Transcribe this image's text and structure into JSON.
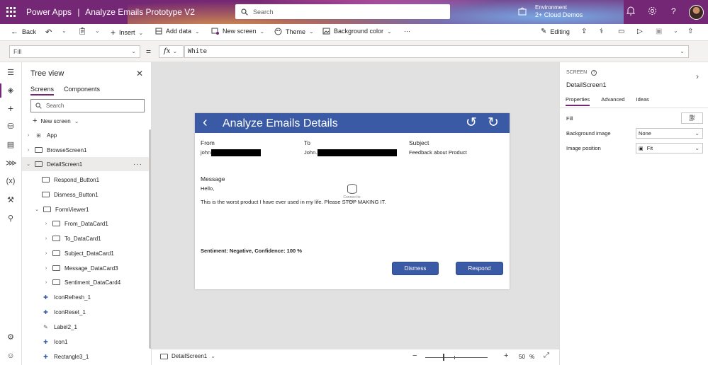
{
  "titlebar": {
    "app_name": "Power Apps",
    "separator": "|",
    "doc_name": "Analyze Emails Prototype V2",
    "search_placeholder": "Search",
    "env_label": "Environment",
    "env_value": "2+ Cloud Demos"
  },
  "commands": {
    "back": "Back",
    "insert": "Insert",
    "add_data": "Add data",
    "new_screen": "New screen",
    "theme": "Theme",
    "background_color": "Background color",
    "more": "···",
    "editing": "Editing"
  },
  "formula_bar": {
    "property": "Fill",
    "equals": "=",
    "fx": "fx",
    "formula": "White"
  },
  "tree": {
    "title": "Tree view",
    "tabs": [
      "Screens",
      "Components"
    ],
    "search_placeholder": "Search",
    "new_screen": "New screen",
    "items": [
      {
        "label": "App"
      },
      {
        "label": "BrowseScreen1"
      },
      {
        "label": "DetailScreen1"
      },
      {
        "label": "Respond_Button1"
      },
      {
        "label": "Dismess_Button1"
      },
      {
        "label": "FormViewer1"
      },
      {
        "label": "From_DataCard1"
      },
      {
        "label": "To_DataCard1"
      },
      {
        "label": "Subject_DataCard1"
      },
      {
        "label": "Message_DataCard3"
      },
      {
        "label": "Sentiment_DataCard4"
      },
      {
        "label": "IconRefresh_1"
      },
      {
        "label": "IconReset_1"
      },
      {
        "label": "Label2_1"
      },
      {
        "label": "Icon1"
      },
      {
        "label": "Rectangle3_1"
      }
    ]
  },
  "app_screen": {
    "title": "Analyze Emails Details",
    "from_label": "From",
    "from_value": "john",
    "to_label": "To",
    "to_value": "John.",
    "subject_label": "Subject",
    "subject_value": "Feedback about Product",
    "message_label": "Message",
    "message_line1": "Hello,",
    "message_line2": "This is the worst product I have ever used in my life. Please STOP MAKING IT.",
    "connect_hint": "Connect to data",
    "sentiment": "Sentiment: Negative, Confidence: 100 %",
    "dismiss": "Dismess",
    "respond": "Respond"
  },
  "statusbar": {
    "screen": "DetailScreen1",
    "zoom": "50",
    "zoom_unit": "%"
  },
  "properties": {
    "kind": "SCREEN",
    "name": "DetailScreen1",
    "tabs": [
      "Properties",
      "Advanced",
      "Ideas"
    ],
    "fill_label": "Fill",
    "bg_image_label": "Background image",
    "bg_image_value": "None",
    "image_position_label": "Image position",
    "image_position_value": "Fit"
  },
  "colors": {
    "brand": "#742774",
    "app_header": "#3b5aa6"
  }
}
